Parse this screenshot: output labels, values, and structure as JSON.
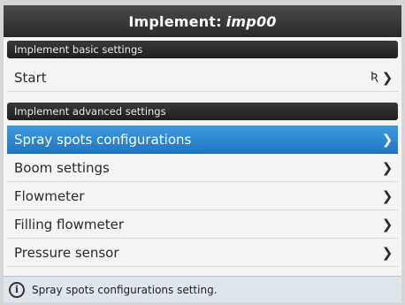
{
  "title": {
    "prefix": "Implement:",
    "name": "imp00"
  },
  "sections": {
    "basic": {
      "label": "Implement basic settings",
      "items": [
        {
          "label": "Start",
          "icon": "pin-icon",
          "pin_glyph": "Ʀ",
          "chevron": "❯"
        }
      ]
    },
    "advanced": {
      "label": "Implement advanced settings",
      "items": [
        {
          "label": "Spray spots configurations",
          "selected": true,
          "chevron": "❯"
        },
        {
          "label": "Boom settings",
          "chevron": "❯"
        },
        {
          "label": "Flowmeter",
          "chevron": "❯"
        },
        {
          "label": "Filling flowmeter",
          "chevron": "❯"
        },
        {
          "label": "Pressure sensor",
          "chevron": "❯"
        }
      ]
    }
  },
  "status": {
    "icon": "info-icon",
    "icon_glyph": "i",
    "text": "Spray spots configurations setting."
  },
  "colors": {
    "selected_row": "#1f76c4",
    "title_bar": "#2a2a2a"
  }
}
